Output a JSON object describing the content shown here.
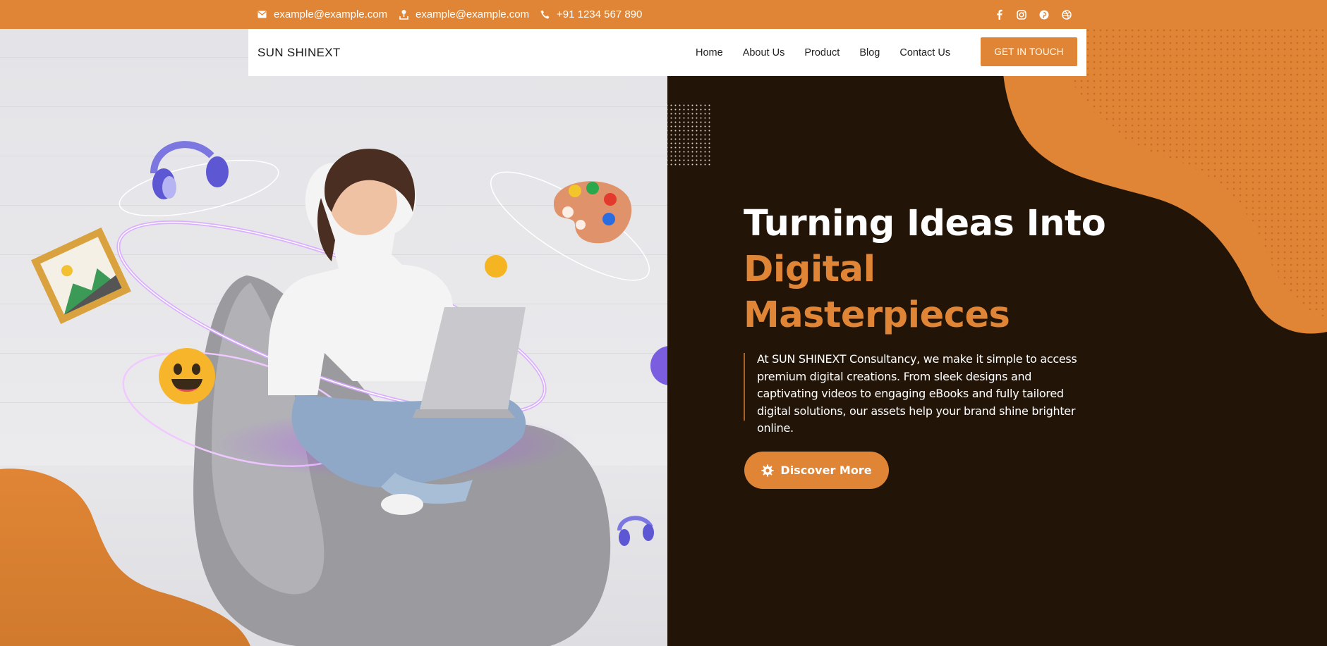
{
  "topbar": {
    "contacts": [
      {
        "icon": "envelope-icon",
        "text": "example@example.com"
      },
      {
        "icon": "location-pin-icon",
        "text": "example@example.com"
      },
      {
        "icon": "phone-icon",
        "text": "+91 1234 567 890"
      }
    ],
    "socials": [
      "facebook-icon",
      "instagram-icon",
      "pinterest-icon",
      "dribbble-icon"
    ]
  },
  "nav": {
    "brand": "SUN SHINEXT",
    "links": [
      "Home",
      "About Us",
      "Product",
      "Blog",
      "Contact Us"
    ],
    "cta": "GET IN TOUCH"
  },
  "hero": {
    "headline_line1": "Turning Ideas Into",
    "headline_line2": "Digital",
    "headline_line3": "Masterpieces",
    "description": "At SUN SHINEXT Consultancy, we make it simple to access premium digital creations. From sleek designs and captivating videos to engaging eBooks and fully tailored digital solutions, our assets help your brand shine brighter online.",
    "button_label": "Discover More",
    "button_icon": "gear-icon"
  },
  "colors": {
    "accent": "#e08535",
    "dark_panel": "#221508",
    "white": "#ffffff"
  }
}
